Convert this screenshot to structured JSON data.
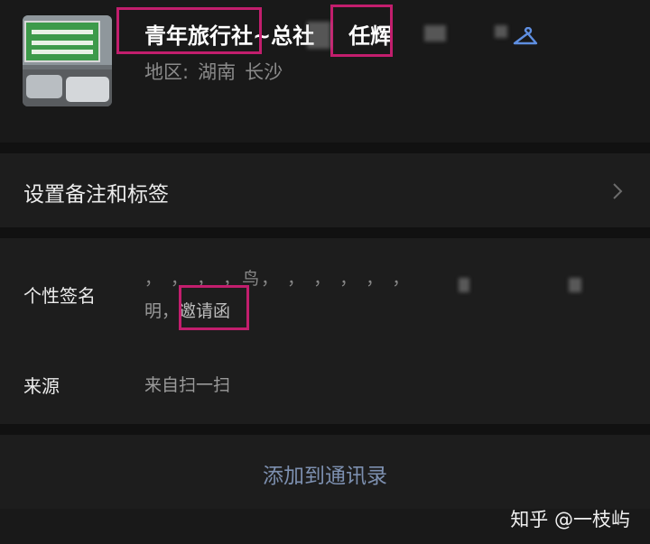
{
  "profile": {
    "nickname": "青年旅行社~总社",
    "nickname_tail": "任辉",
    "region_label": "地区:",
    "province": "湖南",
    "city": "长沙"
  },
  "remark_row": {
    "label": "设置备注和标签"
  },
  "signature": {
    "label": "个性签名",
    "line1": "，   ，     ，   ，鸟，  ，  ，  ，  ，  ，",
    "line2_prefix": "明，",
    "line2_highlight": "邀请函"
  },
  "source": {
    "label": "来源",
    "value": "来自扫一扫"
  },
  "actions": {
    "add_contact_label": "添加到通讯录"
  },
  "watermark": {
    "text": "知乎 @一枝屿"
  },
  "colors": {
    "background": "#191919",
    "row_background": "#1d1d1d",
    "highlight_border": "#c21e6d",
    "link_blue": "#7d90b0"
  }
}
